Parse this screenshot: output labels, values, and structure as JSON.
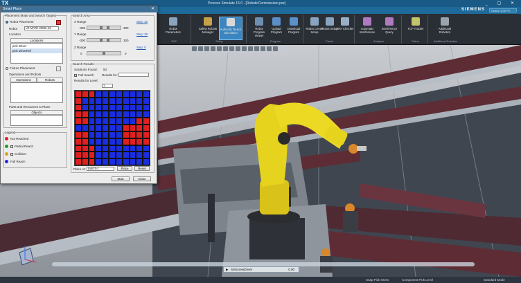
{
  "app": {
    "logo": "TX",
    "title": "Process Simulate 16.0 - [RoboticCommissionr.psz]",
    "brand": "SIEMENS",
    "search_placeholder": "Search (Ctrl+F)",
    "window_controls": "_ ▢ ✕"
  },
  "ribbon": {
    "groups": [
      {
        "label": "ECF",
        "buttons": [
          "Robot Parameters"
        ]
      },
      {
        "label": "Setup",
        "buttons": [
          "Safety Robots Manager",
          "Authentic Reach Simulation"
        ]
      },
      {
        "label": "Program",
        "buttons": [
          "Robot Program Viewer",
          "Upload Program",
          "Download Program"
        ]
      },
      {
        "label": "Check",
        "buttons": [
          "Robot Center Setup",
          "Robot Setup",
          "MFA Checker"
        ]
      },
      {
        "label": "Analysis",
        "buttons": [
          "Automatic Interference",
          "Interference Query"
        ]
      },
      {
        "label": "Paths",
        "buttons": [
          "TCP Tracker"
        ]
      },
      {
        "label": "Additional Robotics",
        "buttons": [
          "Additional Robotics"
        ]
      }
    ]
  },
  "dialog": {
    "title": "Smart Place",
    "close": "✕",
    "placement_mode": {
      "legend": "Placement Mode and Search Targets",
      "robot_placement": "Robot Placement",
      "robot_label": "Robot",
      "robot_value": "LR-MATE-200iD-4S",
      "location_label": "Location",
      "locations_header": "Locations",
      "locations": [
        "pick Driver",
        "pick DriverRef"
      ],
      "fixture_placement": "Fixture Placement",
      "ops_robots_label": "Operations and Robots",
      "ops_columns": [
        "Operations",
        "Robots"
      ],
      "parts_label": "Parts and Resources to Place",
      "objects_header": "Objects"
    },
    "search_area": {
      "legend": "Search Area",
      "x_label": "X Range",
      "y_label": "Y Range",
      "z_label": "Z Range",
      "x_min": "-300",
      "x_max": "300",
      "y_min": "-300",
      "y_max": "300",
      "z_min": "0",
      "z_max": "0",
      "step_link": "Step: 30",
      "step_link_y": "Step: 30",
      "step_link_z": "Step: 0"
    },
    "search_results": {
      "legend": "Search Results",
      "solutions_label": "Solutions Found:",
      "solutions_value": "50",
      "full_search": "Full Search",
      "results_for": "Results for:",
      "results_for_level": "Results for Level:",
      "level_value": "1",
      "place_at_label": "Place At:",
      "place_at_value": "(and 5-1",
      "place_button": "Place",
      "reset_button": "Reset"
    },
    "legend": {
      "title": "Legend",
      "items": [
        {
          "label": "Not Reached",
          "color": "#e02020"
        },
        {
          "label": "Partial Reach",
          "color": "#1e9a1e"
        },
        {
          "label": "Collision",
          "color": "#e0a020"
        },
        {
          "label": "Full Reach",
          "color": "#1a2ee0"
        }
      ]
    },
    "start_button": "Start",
    "close_button": "Close"
  },
  "reach_grid": {
    "rows": 11,
    "cols": 11,
    "cells": [
      "RRRBBBBBBBB",
      "RBBBBBBBBBB",
      "RBBBBBBBBBB",
      "RRBBBBBBBBB",
      "RRBBBBBBBRR",
      "BBBBBBBRRRR",
      "RRBBBBBRRRR",
      "RRBBBBBRRRR",
      "RRRBBBBBBBB",
      "RRRBBBBBBBB",
      "RRRBBBBBBBB"
    ]
  },
  "playback": {
    "label": "SetScrewDriver",
    "time": "0.00"
  },
  "status": {
    "snap": "Snap Pick Intent",
    "component": "Component Pick Level",
    "mode": "Standard Mode"
  }
}
